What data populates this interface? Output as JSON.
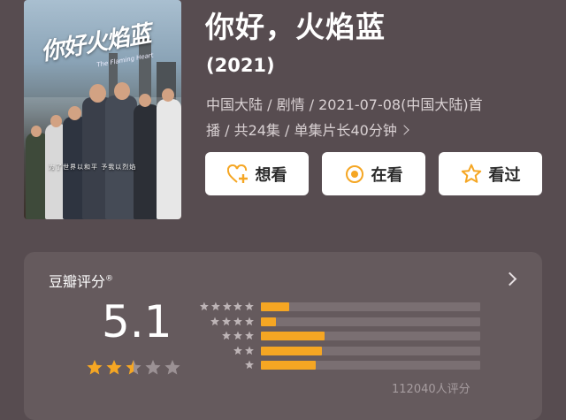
{
  "movie": {
    "title": "你好，火焰蓝",
    "year": "(2021)",
    "info_line1": "中国大陆 / 剧情 / 2021-07-08(中国大陆)首",
    "info_line2": "播 / 共24集 / 单集片长40分钟"
  },
  "poster": {
    "title_text": "你好火焰蓝",
    "subtitle_text": "The Flaming Heart",
    "tagline": "为了世界以和平 予我以烈焰"
  },
  "actions": [
    {
      "label": "想看",
      "icon": "heart-plus-icon"
    },
    {
      "label": "在看",
      "icon": "target-icon"
    },
    {
      "label": "看过",
      "icon": "star-outline-icon"
    }
  ],
  "rating": {
    "title": "豆瓣评分",
    "registered_mark": "®",
    "score": "5.1",
    "stars_value": 2.5,
    "stars_max": 5,
    "distribution": [
      {
        "stars": 5,
        "fraction": 0.13
      },
      {
        "stars": 4,
        "fraction": 0.07
      },
      {
        "stars": 3,
        "fraction": 0.29
      },
      {
        "stars": 2,
        "fraction": 0.28
      },
      {
        "stars": 1,
        "fraction": 0.25
      }
    ],
    "count_text": "112040人评分"
  },
  "colors": {
    "background": "#574c50",
    "card": "#655a5d",
    "accent": "#f5a623",
    "star_empty": "#9b9194"
  }
}
